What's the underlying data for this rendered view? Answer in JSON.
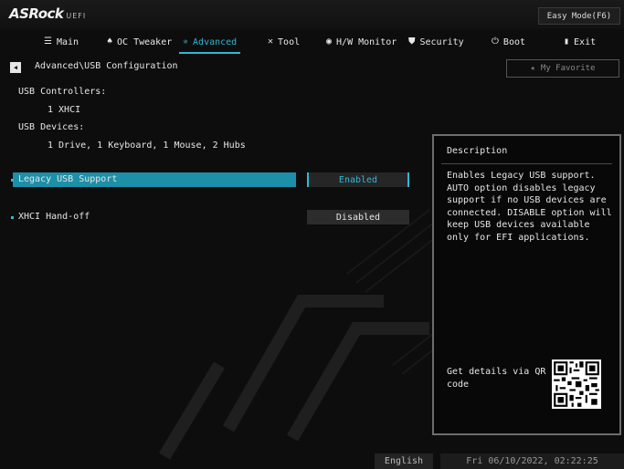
{
  "brand": {
    "logo": "ASRock",
    "suffix": "UEFI"
  },
  "easy_mode_label": "Easy Mode(F6)",
  "nav": [
    {
      "label": "Main",
      "icon": "list-icon",
      "active": false
    },
    {
      "label": "OC Tweaker",
      "icon": "flame-icon",
      "active": false
    },
    {
      "label": "Advanced",
      "icon": "star-icon",
      "active": true
    },
    {
      "label": "Tool",
      "icon": "wrench-icon",
      "active": false
    },
    {
      "label": "H/W Monitor",
      "icon": "monitor-icon",
      "active": false
    },
    {
      "label": "Security",
      "icon": "shield-icon",
      "active": false
    },
    {
      "label": "Boot",
      "icon": "power-icon",
      "active": false
    },
    {
      "label": "Exit",
      "icon": "exit-icon",
      "active": false
    }
  ],
  "breadcrumb": "Advanced\\USB Configuration",
  "favorite_label": "My Favorite",
  "info": {
    "controllers_heading": "USB Controllers:",
    "controllers_value": "1 XHCI",
    "devices_heading": "USB Devices:",
    "devices_value": "1 Drive, 1 Keyboard, 1 Mouse, 2 Hubs"
  },
  "settings": [
    {
      "label": "Legacy USB Support",
      "value": "Enabled",
      "selected": true
    },
    {
      "label": "XHCI Hand-off",
      "value": "Disabled",
      "selected": false
    }
  ],
  "description": {
    "title": "Description",
    "text": "Enables Legacy USB support. AUTO option disables legacy support if no USB devices are connected. DISABLE option will keep USB devices available only for EFI applications.",
    "qr_text": "Get details via QR code"
  },
  "footer": {
    "language": "English",
    "datetime": "Fri 06/10/2022, 02:22:25"
  },
  "colors": {
    "accent": "#2fb8d6",
    "selected_row": "#1d8fa8"
  }
}
